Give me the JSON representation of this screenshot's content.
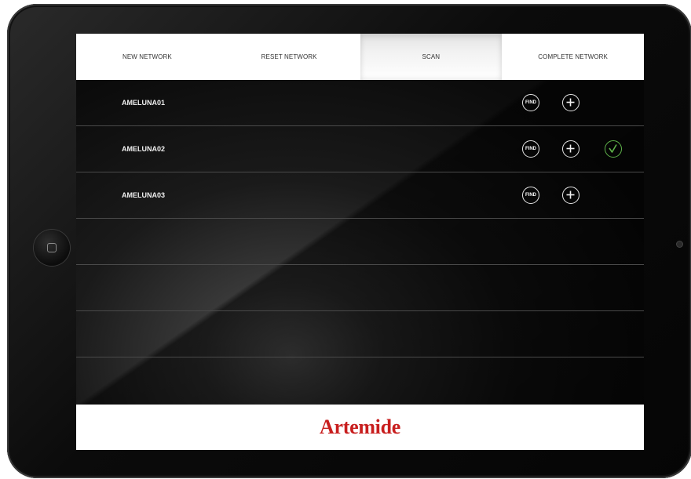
{
  "tabs": [
    {
      "label": "NEW NETWORK",
      "active": false
    },
    {
      "label": "RESET NETWORK",
      "active": false
    },
    {
      "label": "SCAN",
      "active": true
    },
    {
      "label": "COMPLETE NETWORK",
      "active": false
    }
  ],
  "rows": [
    {
      "name": "AMELUNA01",
      "find_label": "FIND",
      "confirmed": false
    },
    {
      "name": "AMELUNA02",
      "find_label": "FIND",
      "confirmed": true
    },
    {
      "name": "AMELUNA03",
      "find_label": "FIND",
      "confirmed": false
    },
    {
      "name": "",
      "empty": true
    },
    {
      "name": "",
      "empty": true
    },
    {
      "name": "",
      "empty": true
    },
    {
      "name": "",
      "empty": true
    }
  ],
  "footer": {
    "logo_text": "Artemide"
  },
  "colors": {
    "brand_red": "#c81e1e",
    "confirm_green": "#5fb34a",
    "list_background": "#111111",
    "tabbar_background": "#ffffff"
  },
  "icons": {
    "find": "find-icon",
    "add": "plus-circle-icon",
    "confirmed": "check-circle-icon",
    "home": "home-button-icon"
  }
}
